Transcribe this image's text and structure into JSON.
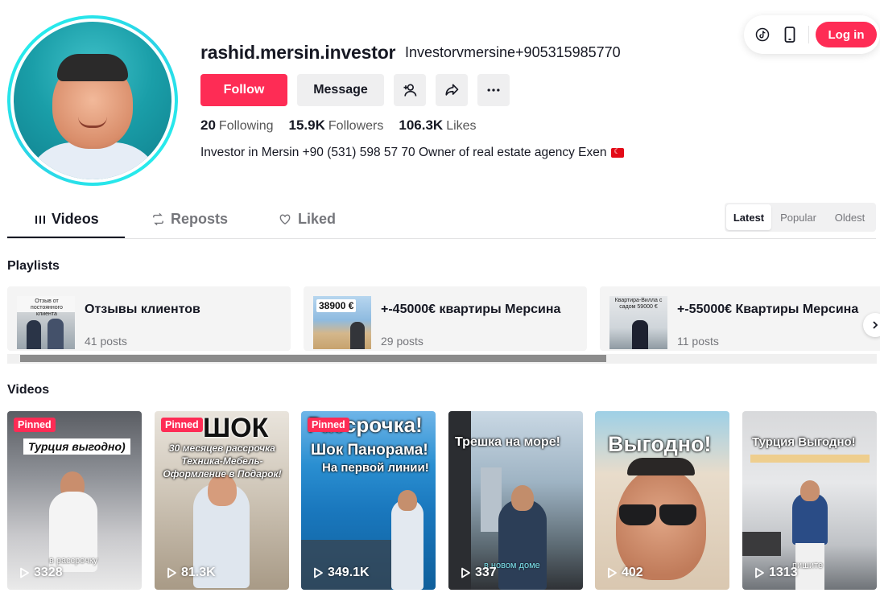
{
  "top_bar": {
    "tiktok_icon": "tiktok-logo-icon",
    "phone_icon": "mobile-phone-icon",
    "login_label": "Log in"
  },
  "profile": {
    "username": "rashid.mersin.investor",
    "nickname": "Investorvmersine+905315985770",
    "follow_label": "Follow",
    "message_label": "Message",
    "stats": {
      "following_count": "20",
      "following_label": "Following",
      "followers_count": "15.9K",
      "followers_label": "Followers",
      "likes_count": "106.3K",
      "likes_label": "Likes"
    },
    "bio": "Investor in Mersin +90 (531) 598 57 70 Owner of real estate agency Exen"
  },
  "tabs": {
    "videos": "Videos",
    "reposts": "Reposts",
    "liked": "Liked"
  },
  "sort": {
    "latest": "Latest",
    "popular": "Popular",
    "oldest": "Oldest"
  },
  "playlists": {
    "heading": "Playlists",
    "items": [
      {
        "title": "Отзывы клиентов",
        "posts": "41 posts",
        "thumb_text": "Отзыв от постоянного клиента"
      },
      {
        "title": "+-45000€ квартиры Мерсина",
        "posts": "29 posts",
        "thumb_text": "38900 €"
      },
      {
        "title": "+-55000€ Квартиры Мерсина",
        "posts": "11 posts",
        "thumb_text": "Квартира-Вилла с садом 59000 €"
      }
    ]
  },
  "videos": {
    "heading": "Videos",
    "pinned_label": "Pinned",
    "items": [
      {
        "views": "3328",
        "pinned": true,
        "text": "Турция выгодно)",
        "caption": "в рассрочку"
      },
      {
        "views": "81.3K",
        "pinned": true,
        "text": "ШОК",
        "subtext": "30 месяцев рассрочка Техника-Мебель- Оформление в Подарок!"
      },
      {
        "views": "349.1K",
        "pinned": true,
        "text": "Рассрочка!",
        "subtext": "Шок Панорама!",
        "subtext2": "На первой линии!"
      },
      {
        "views": "337",
        "pinned": false,
        "text": "Трешка на море!",
        "caption": "в новом доме"
      },
      {
        "views": "402",
        "pinned": false,
        "text": "Выгодно!"
      },
      {
        "views": "1313",
        "pinned": false,
        "text": "Турция Выгодно!",
        "caption": "пишите"
      }
    ]
  }
}
